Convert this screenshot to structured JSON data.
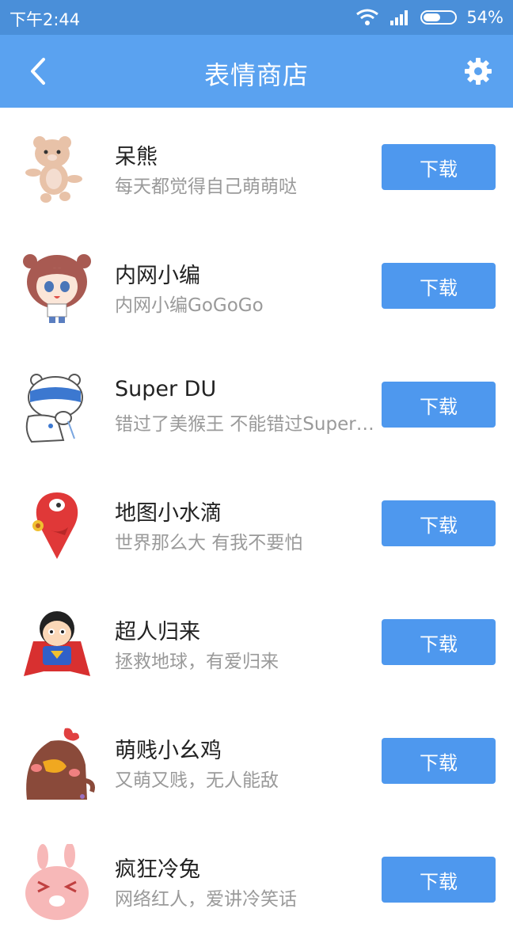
{
  "status": {
    "time": "下午2:44",
    "battery": "54%",
    "battery_fraction": 0.54
  },
  "header": {
    "title": "表情商店"
  },
  "items": [
    {
      "name": "呆熊",
      "desc": "每天都觉得自己萌萌哒",
      "button": "下载",
      "icon": "bear-sticker-icon"
    },
    {
      "name": "内网小编",
      "desc": "内网小编GoGoGo",
      "button": "下载",
      "icon": "girl-sticker-icon"
    },
    {
      "name": "Super DU",
      "desc": "错过了美猴王 不能错过Super DU",
      "button": "下载",
      "icon": "polar-bear-sticker-icon"
    },
    {
      "name": "地图小水滴",
      "desc": "世界那么大 有我不要怕",
      "button": "下载",
      "icon": "map-drop-sticker-icon"
    },
    {
      "name": "超人归来",
      "desc": "拯救地球，有爱归来",
      "button": "下载",
      "icon": "superman-sticker-icon"
    },
    {
      "name": "萌贱小幺鸡",
      "desc": "又萌又贱，无人能敌",
      "button": "下载",
      "icon": "chicken-sticker-icon"
    },
    {
      "name": "疯狂冷兔",
      "desc": "网络红人，爱讲冷笑话",
      "button": "下载",
      "icon": "rabbit-sticker-icon"
    }
  ]
}
